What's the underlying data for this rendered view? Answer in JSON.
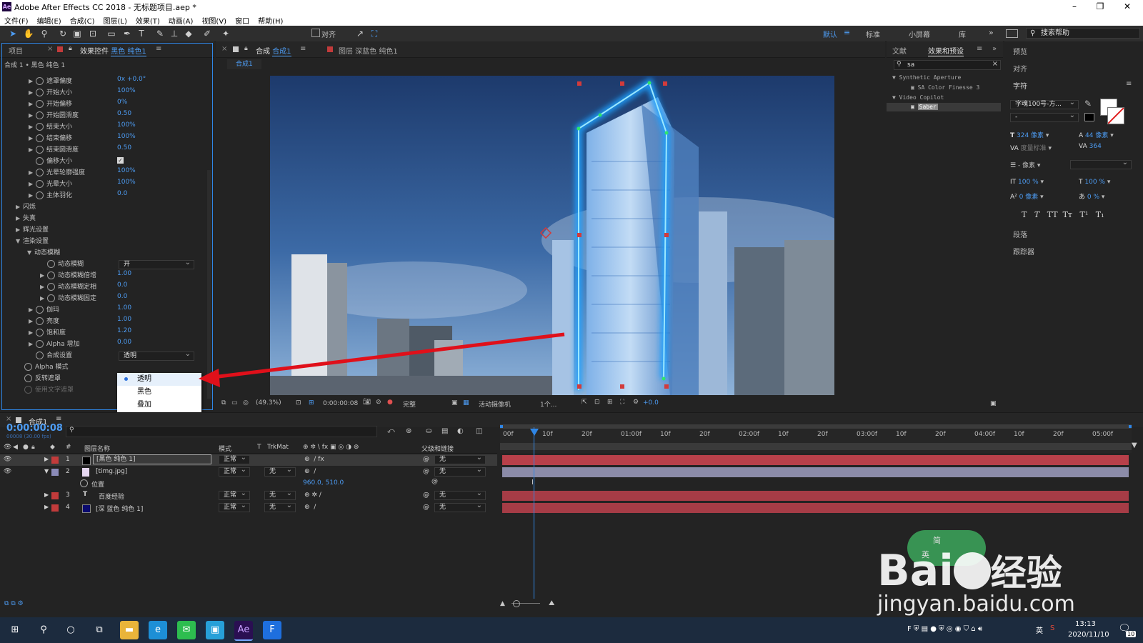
{
  "app": {
    "title": "Adobe After Effects CC 2018 - 无标题项目.aep *",
    "logo": "Ae"
  },
  "window_buttons": [
    "–",
    "❐",
    "✕"
  ],
  "menu": [
    "文件(F)",
    "编辑(E)",
    "合成(C)",
    "图层(L)",
    "效果(T)",
    "动画(A)",
    "视图(V)",
    "窗口",
    "帮助(H)"
  ],
  "toolbar": {
    "align_label": "对齐",
    "workspaces": [
      "默认",
      "标准",
      "小屏幕",
      "库"
    ],
    "search_placeholder": "搜索帮助"
  },
  "left_panel": {
    "tab_project": "项目",
    "tab_effect_prefix": "效果控件",
    "tab_effect_layer": "黑色 纯色1",
    "breadcrumb": "合成 1 • 黑色 纯色 1",
    "props": [
      {
        "label": "遮罩偏度",
        "value": "0x +0.0°",
        "kind": "num"
      },
      {
        "label": "开始大小",
        "value": "100%",
        "kind": "num"
      },
      {
        "label": "开始偏移",
        "value": "0%",
        "kind": "num"
      },
      {
        "label": "开始圆滑度",
        "value": "0.50",
        "kind": "num"
      },
      {
        "label": "结束大小",
        "value": "100%",
        "kind": "num"
      },
      {
        "label": "结束偏移",
        "value": "100%",
        "kind": "num"
      },
      {
        "label": "结束圆滑度",
        "value": "0.50",
        "kind": "num"
      },
      {
        "label": "偏移大小",
        "value": "",
        "kind": "check"
      },
      {
        "label": "光晕轮廓强度",
        "value": "100%",
        "kind": "num"
      },
      {
        "label": "光晕大小",
        "value": "100%",
        "kind": "num"
      },
      {
        "label": "主体羽化",
        "value": "0.0",
        "kind": "num"
      }
    ],
    "groups": [
      "闪烁",
      "失真",
      "辉光设置",
      "渲染设置"
    ],
    "motion_blur_group": "动态模糊",
    "motion_blur_props": [
      {
        "label": "动态模糊",
        "value": "开",
        "kind": "dropdown"
      },
      {
        "label": "动态模糊倍增",
        "value": "1.00",
        "kind": "num"
      },
      {
        "label": "动态模糊定相",
        "value": "0.0",
        "kind": "num"
      },
      {
        "label": "动态模糊固定",
        "value": "0.0",
        "kind": "num"
      }
    ],
    "render_props": [
      {
        "label": "伽玛",
        "value": "1.00"
      },
      {
        "label": "亮度",
        "value": "1.00"
      },
      {
        "label": "饱和度",
        "value": "1.20"
      },
      {
        "label": "Alpha 增加",
        "value": "0.00"
      }
    ],
    "composite_label": "合成设置",
    "composite_value": "透明",
    "alpha_mode": "Alpha 模式",
    "invert_mask": "反转遮罩",
    "use_text_mask": "使用文字遮罩",
    "popup_options": [
      "透明",
      "黑色",
      "叠加"
    ]
  },
  "viewer": {
    "tab_comp_prefix": "合成",
    "tab_comp_name": "合成1",
    "tab_layer": "图层 深蓝色 纯色1",
    "comp_tab_label": "合成1",
    "zoom": "(49.3%)",
    "timecode": "0:00:00:08",
    "resolution": "完整",
    "camera": "活动摄像机",
    "views": "1个...",
    "exposure": "+0.0"
  },
  "effects_panel": {
    "tab_info": "文献",
    "tab_effects": "效果和预设",
    "search_value": "sa",
    "tree": [
      {
        "label": "Synthetic Aperture",
        "level": 0
      },
      {
        "label": "SA Color Finesse 3",
        "level": 1
      },
      {
        "label": "Video Copilot",
        "level": 0
      },
      {
        "label": "Saber",
        "level": 1
      }
    ]
  },
  "right_panel": {
    "preview": "预览",
    "align": "对齐",
    "character": "字符",
    "font": "字魂100号-方...",
    "font_style": "-",
    "font_size": "324 像素",
    "leading": "44 像素",
    "kerning": "度量标准",
    "tracking": "364",
    "stroke_width": "- 像素",
    "vscale": "100 %",
    "hscale": "100 %",
    "baseline": "0 像素",
    "tsume": "0 %",
    "style_buttons": [
      "T",
      "T",
      "TT",
      "Tт",
      "T¹",
      "T₁"
    ],
    "paragraph": "段落",
    "tracker": "跟踪器"
  },
  "timeline": {
    "tab": "合成1",
    "timecode": "0:00:00:08",
    "fps": "00008 (30.00 fps)",
    "columns": {
      "name": "图层名称",
      "mode": "模式",
      "t": "T",
      "trkmat": "TrkMat",
      "parent": "父级和链接"
    },
    "ruler": [
      "00f",
      "10f",
      "20f",
      "01:00f",
      "10f",
      "20f",
      "02:00f",
      "10f",
      "20f",
      "03:00f",
      "10f",
      "20f",
      "04:00f",
      "10f",
      "20f",
      "05:00f"
    ],
    "layers": [
      {
        "num": "1",
        "name": "[黑色 纯色 1]",
        "mode": "正常",
        "trkmat": "",
        "parent": "无",
        "color": "#c23b3b",
        "swatch": "#000000"
      },
      {
        "num": "2",
        "name": "[timg.jpg]",
        "mode": "正常",
        "trkmat": "无",
        "parent": "无",
        "color": "#8b8bb8",
        "swatch": "#e7d8f1"
      },
      {
        "num": "3",
        "name": "百度经验",
        "mode": "正常",
        "trkmat": "无",
        "parent": "无",
        "color": "#c23b3b",
        "swatch": "text"
      },
      {
        "num": "4",
        "name": "[深 蓝色 纯色 1]",
        "mode": "正常",
        "trkmat": "无",
        "parent": "无",
        "color": "#c23b3b",
        "swatch": "#0a0a6e"
      }
    ],
    "sub_prop": {
      "label": "位置",
      "value": "960.0, 510.0"
    }
  },
  "taskbar": {
    "time": "13:13",
    "date": "2020/11/10",
    "lang": "英",
    "notif": "10"
  },
  "watermark": {
    "logo_text": "Bai",
    "logo_text2": "经验",
    "url": "jingyan.baidu.com",
    "badge_top": "简",
    "badge_bottom": "英"
  }
}
